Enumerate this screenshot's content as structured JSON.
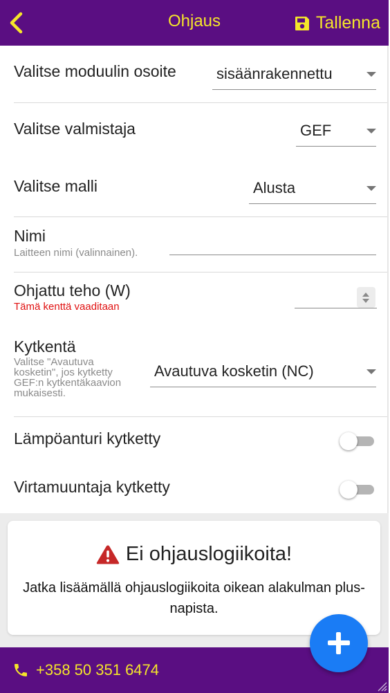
{
  "header": {
    "title": "Ohjaus",
    "save_label": "Tallenna",
    "back_icon": "chevron-left-icon",
    "save_icon": "floppy-disk-icon"
  },
  "form": {
    "module_address": {
      "label": "Valitse moduulin osoite",
      "value": "sisäänrakennettu"
    },
    "manufacturer": {
      "label": "Valitse valmistaja",
      "value": "GEF"
    },
    "model": {
      "label": "Valitse malli",
      "value": "Alusta"
    },
    "name": {
      "label": "Nimi",
      "hint": "Laitteen nimi (valinnainen).",
      "value": ""
    },
    "power": {
      "label": "Ohjattu teho (W)",
      "error": "Tämä kenttä vaaditaan",
      "value": ""
    },
    "wiring": {
      "label": "Kytkentä",
      "hint": "Valitse \"Avautuva kosketin\", jos kytketty GEF:n kytkentäkaavion mukaisesti.",
      "value": "Avautuva kosketin (NC)"
    },
    "temp_sensor": {
      "label": "Lämpöanturi kytketty",
      "checked": false
    },
    "current_transformer": {
      "label": "Virtamuuntaja kytketty",
      "checked": false
    }
  },
  "notice": {
    "title": "Ei ohjauslogiikoita!",
    "text": "Jatka lisäämällä ohjauslogiikoita oikean alakulman plus-napista.",
    "icon": "warning-triangle-icon"
  },
  "footer": {
    "phone": "+358 50 351 6474",
    "phone_icon": "phone-icon"
  },
  "fab": {
    "icon": "plus-icon"
  },
  "colors": {
    "brand": "#5a0e82",
    "accent": "#f5e62a",
    "fab": "#1a7cf5",
    "warning": "#c62828",
    "error": "#e01010"
  }
}
